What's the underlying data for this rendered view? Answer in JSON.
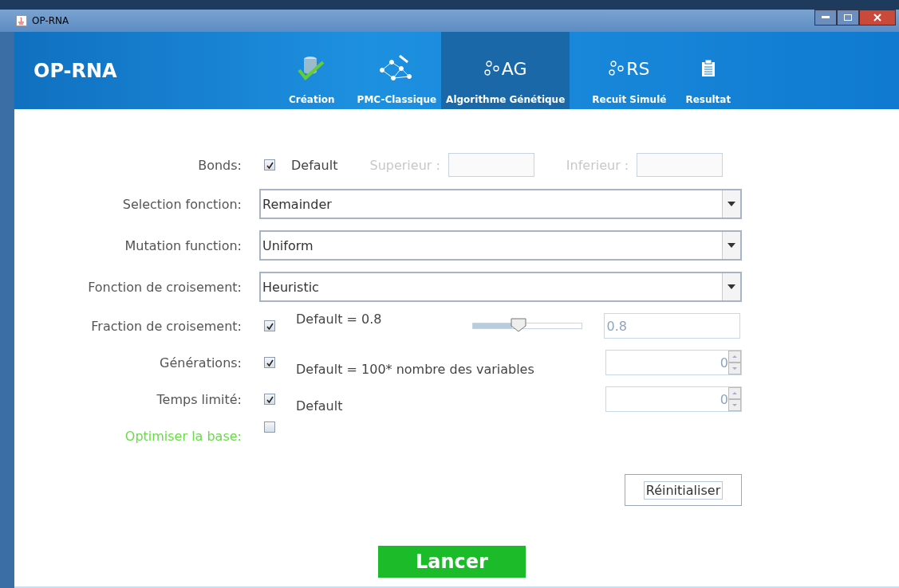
{
  "window": {
    "title": "OP-RNA"
  },
  "header": {
    "app_name": "OP-RNA"
  },
  "tabs": [
    {
      "label": "Création",
      "kind": "database",
      "selected": false
    },
    {
      "label": "PMC-Classique",
      "kind": "network",
      "selected": false
    },
    {
      "label": "Algorithme Génétique",
      "kind": "glyph",
      "glyph": "AG",
      "selected": true
    },
    {
      "label": "Recuit Simulé",
      "kind": "glyph",
      "glyph": "RS",
      "selected": false
    },
    {
      "label": "Resultat",
      "kind": "clipboard",
      "selected": false
    }
  ],
  "rows": [
    {
      "kind": "bounds",
      "label": "Bonds:",
      "color": "#555555",
      "checked": true,
      "option": "Default",
      "upper_label": "Superieur :",
      "lower_label": "Inferieur :",
      "disabled": true
    },
    {
      "kind": "select",
      "label": "Selection fonction:",
      "color": "#555555",
      "value": "Remainder"
    },
    {
      "kind": "select",
      "label": "Mutation function:",
      "color": "#555555",
      "value": "Uniform"
    },
    {
      "kind": "select",
      "label": "Fonction de croisement:",
      "color": "#555555",
      "value": "Heuristic"
    },
    {
      "kind": "slider",
      "label": "Fraction de croisement:",
      "color": "#555555",
      "checked": true,
      "option": "Default = 0.8",
      "level": 0.36,
      "value": "0.8",
      "disabled": true
    },
    {
      "kind": "spinner",
      "label": "Générations:",
      "color": "#555555",
      "checked": true,
      "option": "Default = 100* nombre des variables",
      "value": "0",
      "disabled": true
    },
    {
      "kind": "spinner",
      "label": "Temps limité:",
      "color": "#555555",
      "checked": true,
      "option": "Default",
      "value": "0",
      "disabled": true
    },
    {
      "kind": "check",
      "label": "Optimiser la base:",
      "color": "#66dd44",
      "checked": false
    }
  ],
  "buttons": {
    "reset": "Réinitialiser",
    "run": "Lancer"
  }
}
